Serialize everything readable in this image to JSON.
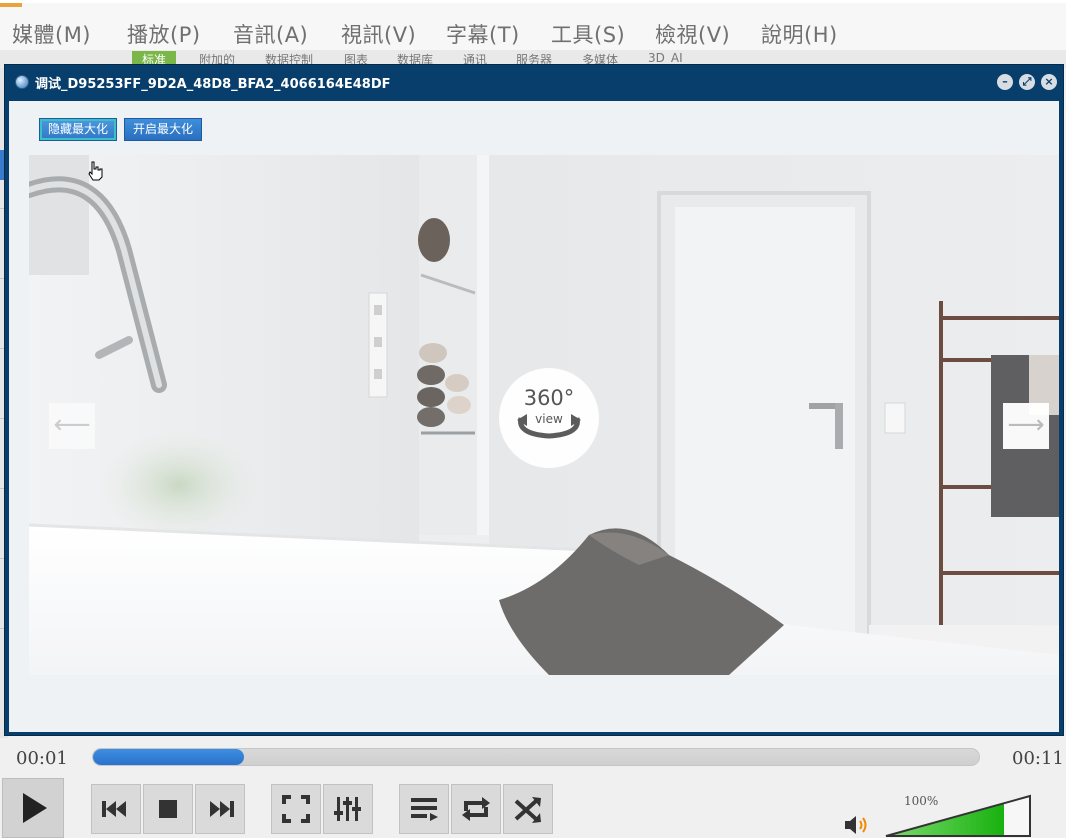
{
  "menubar": {
    "items": [
      "媒體(M)",
      "播放(P)",
      "音訊(A)",
      "視訊(V)",
      "字幕(T)",
      "工具(S)",
      "檢視(V)",
      "說明(H)"
    ]
  },
  "bg_tabs": [
    "标准",
    "附加的",
    "数据控制",
    "图表",
    "数据库",
    "通讯",
    "服务器",
    "多媒体",
    "3D_AI"
  ],
  "dialog": {
    "title": "调试_D95253FF_9D2A_48D8_BFA2_4066164E48DF",
    "buttons": {
      "hide": "隐藏最大化",
      "show": "开启最大化"
    }
  },
  "viewer": {
    "badge_number": "360°",
    "badge_label": "view",
    "prev_glyph": "⟵",
    "next_glyph": "⟶"
  },
  "player": {
    "elapsed": "00:01",
    "total": "00:11",
    "progress": 0.17,
    "volume_label": "100%",
    "volume": 1.0
  },
  "colors": {
    "window_title_bg": "#073e6b",
    "button_blue": "#2a6fbf",
    "progress_blue": "#2a72cc",
    "volume_green": "#2fc02a"
  },
  "icons": {
    "controls": [
      "play-icon",
      "previous-icon",
      "stop-icon",
      "next-icon",
      "fullscreen-icon",
      "extended-settings-icon",
      "playlist-icon",
      "loop-icon",
      "shuffle-icon",
      "speaker-icon"
    ]
  }
}
